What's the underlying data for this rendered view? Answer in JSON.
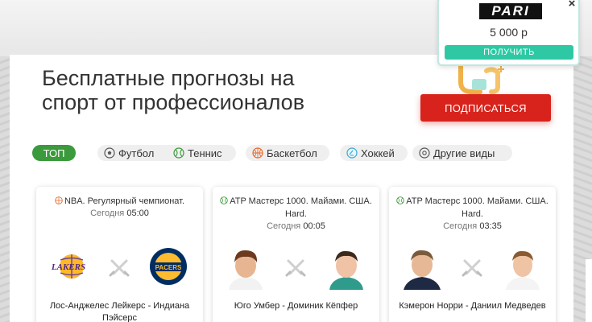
{
  "header": {
    "headline_line1": "Бесплатные прогнозы на",
    "headline_line2": "спорт от профессионалов",
    "subscribe_label": "ПОДПИСАТЬСЯ"
  },
  "promo": {
    "logo_text": "PARI",
    "amount": "5 000 р",
    "button_label": "ПОЛУЧИТЬ",
    "close_symbol": "×"
  },
  "tabs": [
    {
      "label": "ТОП",
      "icon": "none",
      "active": true
    },
    {
      "label": "Футбол",
      "icon": "football-icon",
      "active": false
    },
    {
      "label": "Теннис",
      "icon": "tennis-icon",
      "active": false
    },
    {
      "label": "Баскетбол",
      "icon": "basketball-icon",
      "active": false
    },
    {
      "label": "Хоккей",
      "icon": "hockey-icon",
      "active": false
    },
    {
      "label": "Другие виды",
      "icon": "other-sports-icon",
      "active": false
    }
  ],
  "matches": [
    {
      "league": "NBA. Регулярный чемпионат.",
      "league_icon": "basketball-icon",
      "time_prefix": "Сегодня",
      "time": "05:00",
      "teams": "Лос-Анджелес Лейкерс - Индиана Пэйсерс",
      "home_logo_text": "LAKERS",
      "away_logo_text": "PACERS"
    },
    {
      "league": "ATP Мастерс 1000. Майами. США. Hard.",
      "league_icon": "tennis-icon",
      "time_prefix": "Сегодня",
      "time": "00:05",
      "teams": "Юго Умбер - Доминик Кёпфер"
    },
    {
      "league": "ATP Мастерс 1000. Майами. США. Hard.",
      "league_icon": "tennis-icon",
      "time_prefix": "Сегодня",
      "time": "03:35",
      "teams": "Кэмерон Норри - Даниил Медведев"
    }
  ],
  "colors": {
    "accent_green": "#3b9a3c",
    "subscribe_red": "#d8231c",
    "promo_teal": "#2ec9a4"
  }
}
